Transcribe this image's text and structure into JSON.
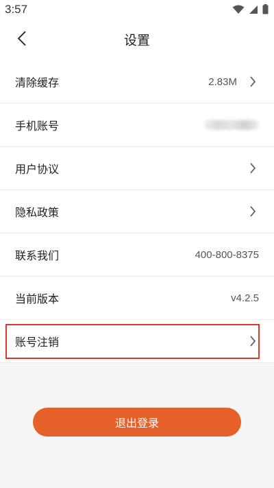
{
  "status_bar": {
    "time": "3:57",
    "icons": [
      "wifi-icon",
      "signal-icon",
      "battery-icon"
    ]
  },
  "header": {
    "title": "设置",
    "back_icon": "chevron-left-icon"
  },
  "settings": {
    "items": [
      {
        "label": "清除缓存",
        "value": "2.83M",
        "has_chevron": true
      },
      {
        "label": "手机账号",
        "value": "",
        "blurred": true,
        "has_chevron": false
      },
      {
        "label": "用户协议",
        "value": "",
        "has_chevron": true
      },
      {
        "label": "隐私政策",
        "value": "",
        "has_chevron": true
      },
      {
        "label": "联系我们",
        "value": "400-800-8375",
        "has_chevron": false
      },
      {
        "label": "当前版本",
        "value": "v4.2.5",
        "has_chevron": false
      },
      {
        "label": "账号注销",
        "value": "",
        "has_chevron": true,
        "highlighted": true
      }
    ]
  },
  "logout": {
    "label": "退出登录"
  },
  "colors": {
    "accent": "#e6602a",
    "highlight_border": "#e0342e"
  }
}
